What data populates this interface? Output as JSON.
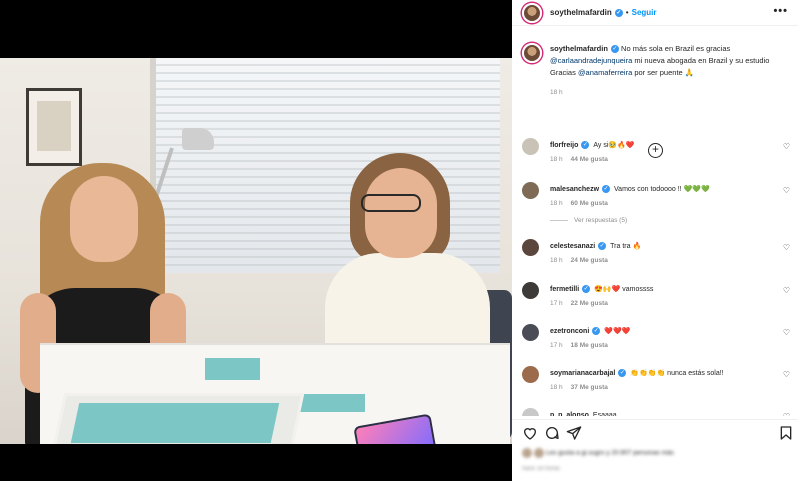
{
  "post": {
    "username": "soythelmafardin",
    "follow_label": "Seguir",
    "more_label": "•••",
    "caption_user": "soythelmafardin",
    "caption_parts": [
      "No más sola en Brazil es gracias ",
      "@carlaandradejunqueira",
      " mi nueva abogada en Brazil y su estudio",
      "Gracias ",
      "@anamaferreira",
      " por ser puente 🙏"
    ],
    "caption_time": "18 h",
    "load_more_icon": "plus-circle-icon"
  },
  "comments": [
    {
      "user": "florfreijo",
      "verified": true,
      "text": "Ay si🥹🔥❤️",
      "time": "18 h",
      "likes": "44 Me gusta",
      "reply": "",
      "avatar_color": "#c9c2b6"
    },
    {
      "user": "malesanchezw",
      "verified": true,
      "text": "Vamos con todoooo !! 💚💚💚",
      "time": "18 h",
      "likes": "60 Me gusta",
      "reply": "",
      "avatar_color": "#7e6a55",
      "view_replies": "Ver respuestas (5)"
    },
    {
      "user": "celestesanazi",
      "verified": true,
      "text": "Tra tra 🔥",
      "time": "18 h",
      "likes": "24 Me gusta",
      "reply": "",
      "avatar_color": "#5b463d"
    },
    {
      "user": "fermetilli",
      "verified": true,
      "text": "😍🙌❤️ vamossss",
      "time": "17 h",
      "likes": "22 Me gusta",
      "reply": "",
      "avatar_color": "#3d3a37"
    },
    {
      "user": "ezetronconi",
      "verified": true,
      "text": "❤️❤️❤️",
      "time": "17 h",
      "likes": "18 Me gusta",
      "reply": "",
      "avatar_color": "#4a4d55"
    },
    {
      "user": "soymarianacarbajal",
      "verified": true,
      "text": "👏👏👏👏 nunca estás sola!!",
      "time": "18 h",
      "likes": "37 Me gusta",
      "reply": "",
      "avatar_color": "#9c6b4c"
    },
    {
      "user": "p_p_alonso",
      "verified": false,
      "text": "Esaaaa",
      "time": "",
      "likes": "",
      "reply": "",
      "avatar_color": "#c8c8c8"
    }
  ],
  "actions": {
    "like_icon": "heart-icon",
    "comment_icon": "comment-icon",
    "share_icon": "share-icon",
    "save_icon": "bookmark-icon"
  },
  "footer": {
    "likes_text": "Les gusta a gi.sugro y 20.907 personas más",
    "date_text": "hace 18 horas"
  },
  "colors": {
    "accent": "#0095f6",
    "verified": "#3897f0",
    "ring": "#d62976"
  }
}
